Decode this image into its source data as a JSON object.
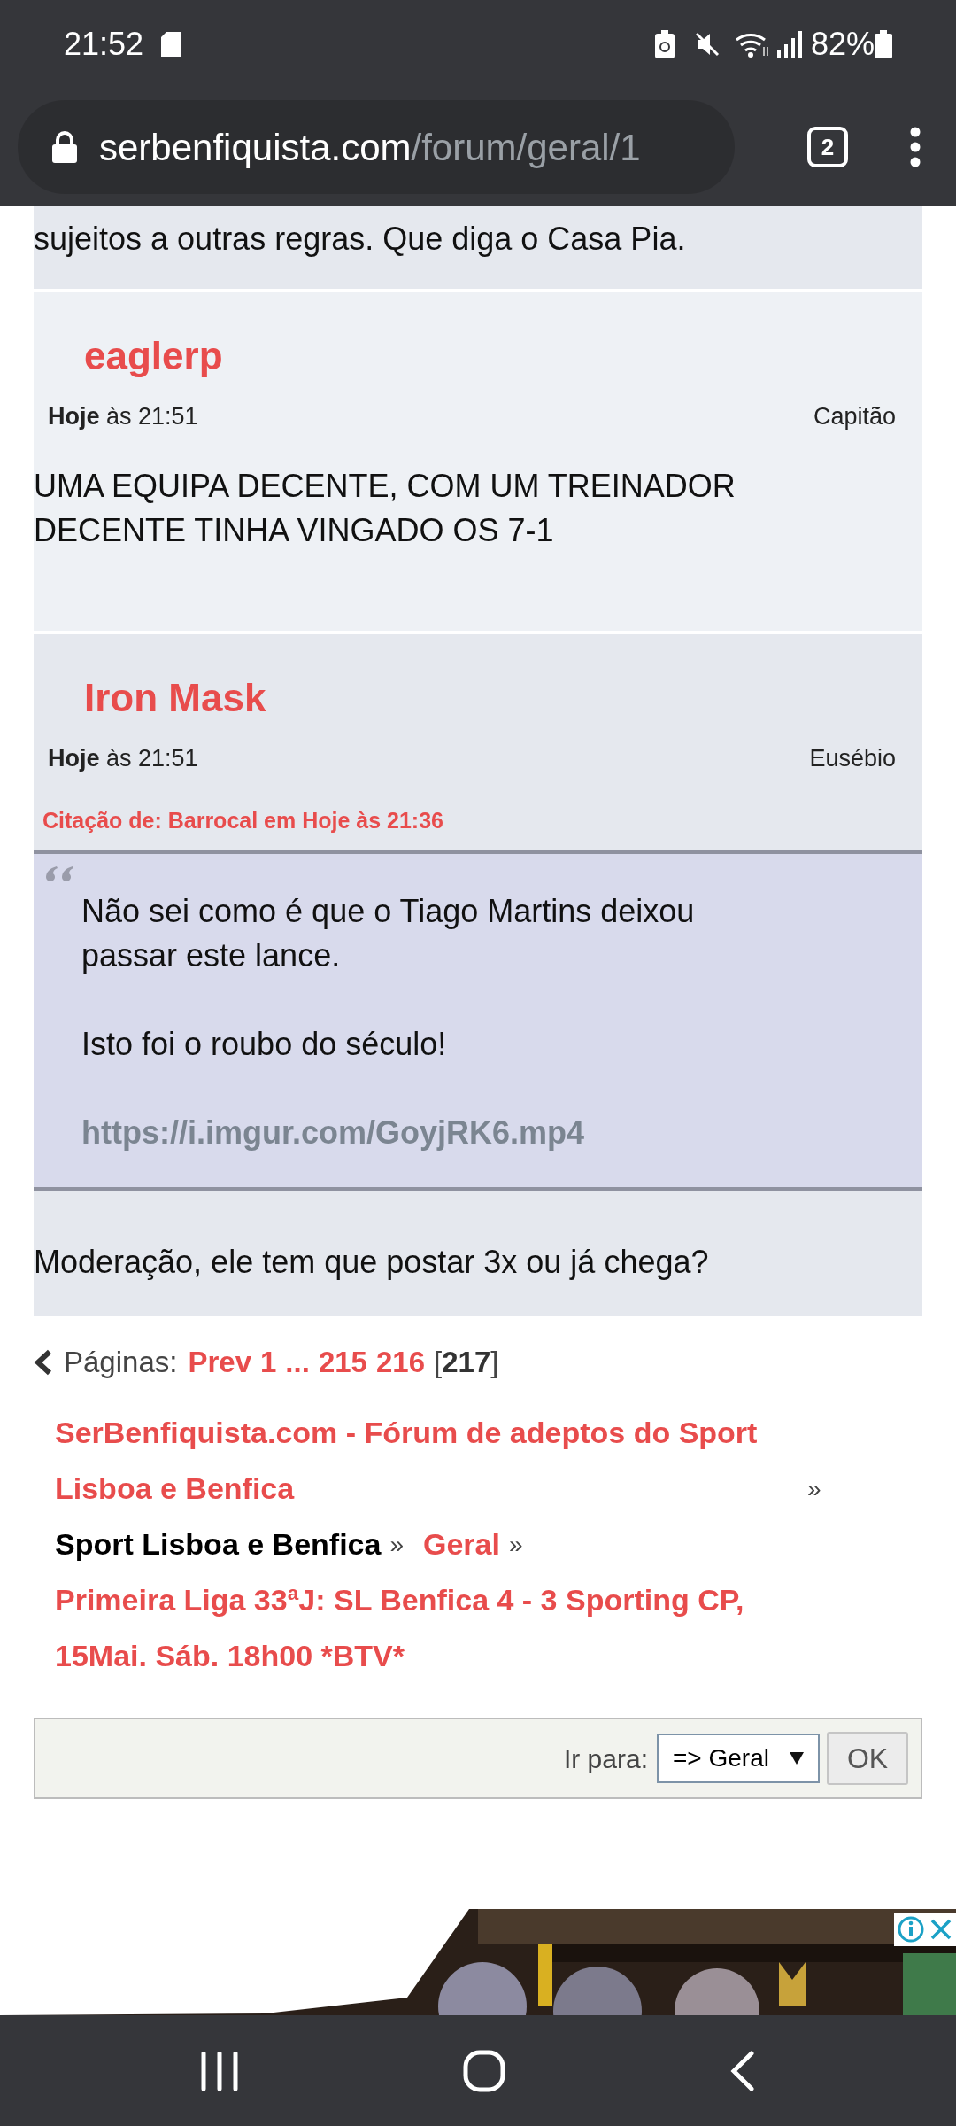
{
  "status_bar": {
    "time": "21:52",
    "battery": "82%"
  },
  "browser": {
    "url_host": "serbenfiquista.com",
    "url_path": "/forum/geral/1",
    "tab_count": "2"
  },
  "posts": [
    {
      "kind": "partial",
      "body": "sujeitos a outras regras. Que diga o Casa Pia."
    },
    {
      "kind": "post",
      "author": "eaglerp",
      "day": "Hoje",
      "time": "às 21:51",
      "rank": "Capitão",
      "body": "UMA EQUIPA DECENTE, COM UM TREINADOR DECENTE TINHA VINGADO OS 7-1"
    },
    {
      "kind": "post",
      "author": "Iron Mask",
      "day": "Hoje",
      "time": "às 21:51",
      "rank": "Eusébio",
      "quote": {
        "header": "Citação de: Barrocal em Hoje às 21:36",
        "paragraphs": [
          "Não sei como é que o Tiago Martins deixou passar este lance.",
          "Isto foi o roubo do século!"
        ],
        "link": "https://i.imgur.com/GoyjRK6.mp4"
      },
      "body": "Moderação, ele tem que postar 3x ou já chega?"
    }
  ],
  "pagination": {
    "label": "Páginas:",
    "items": [
      {
        "kind": "link",
        "text": "Prev"
      },
      {
        "kind": "link",
        "text": "1"
      },
      {
        "kind": "ellipsis",
        "text": "..."
      },
      {
        "kind": "link",
        "text": "215"
      },
      {
        "kind": "link",
        "text": "216"
      },
      {
        "kind": "current",
        "text": "217",
        "before": "[",
        "after": "]"
      }
    ]
  },
  "breadcrumbs": [
    {
      "kind": "link",
      "text": "SerBenfiquista.com - Fórum de adeptos do Sport Lisboa e Benfica",
      "separator": "»"
    },
    {
      "kind": "plain",
      "text": "Sport Lisboa e Benfica",
      "separator": "»"
    },
    {
      "kind": "link",
      "text": "Geral",
      "separator": "»"
    },
    {
      "kind": "link",
      "text": "Primeira Liga 33ªJ: SL Benfica 4 - 3 Sporting CP, 15Mai. Sáb. 18h00 *BTV*"
    }
  ],
  "jump": {
    "label": "Ir para:",
    "value": "=> Geral",
    "button": "OK"
  }
}
